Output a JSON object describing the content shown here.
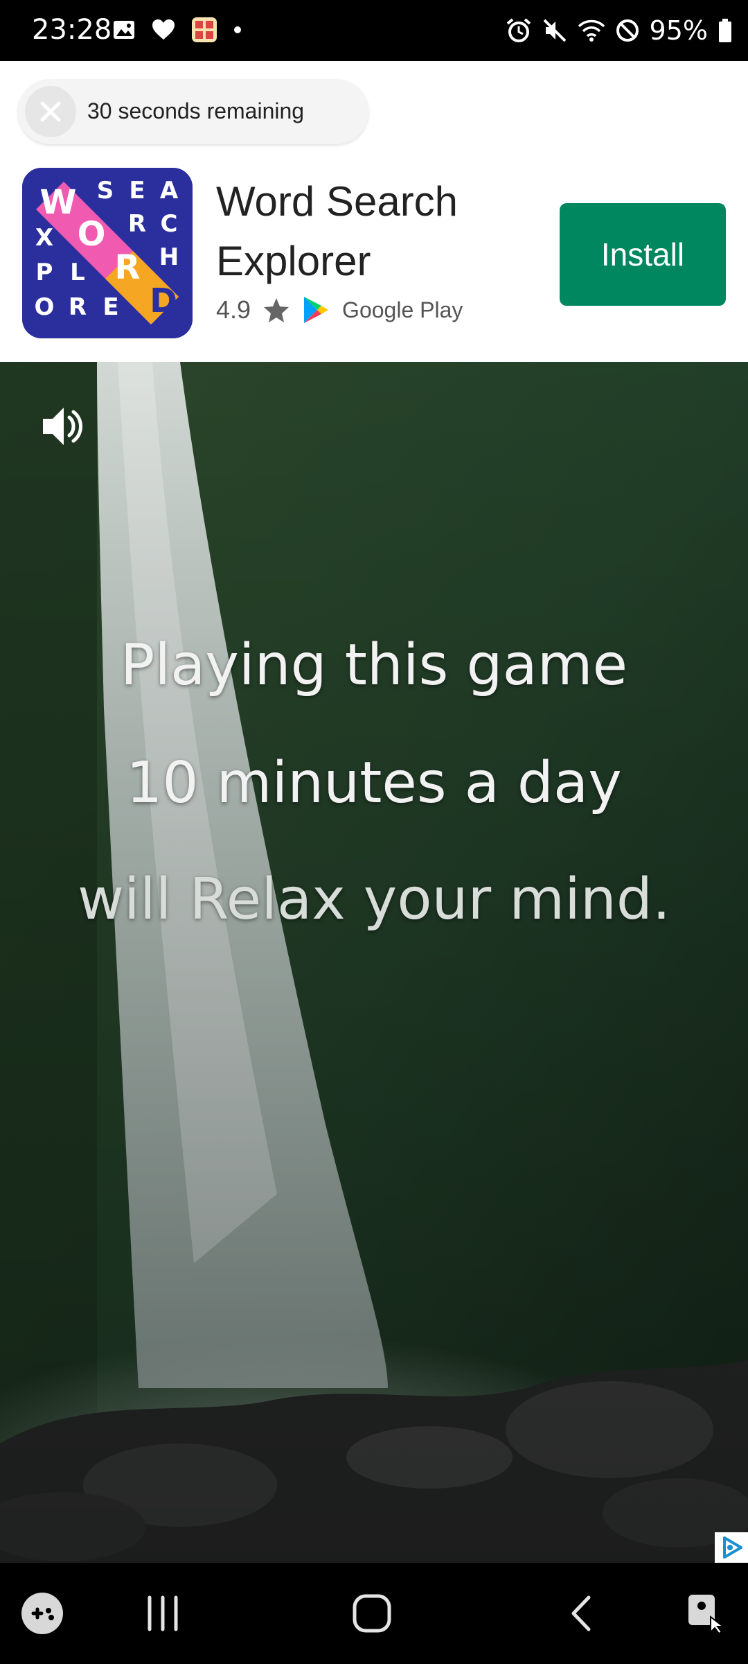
{
  "status_bar": {
    "time": "23:28",
    "battery": "95%",
    "left_icons": [
      "image-icon",
      "heart-icon",
      "game-app-icon",
      "dot-icon"
    ],
    "right_icons": [
      "alarm-icon",
      "mute-icon",
      "wifi-icon",
      "dnd-icon",
      "battery-icon"
    ]
  },
  "ad": {
    "timer_text": "30 seconds remaining",
    "app_name": "Word Search Explorer",
    "rating": "4.9",
    "store": "Google Play",
    "install_label": "Install",
    "icon_letters": [
      "W",
      "S",
      "E",
      "A",
      "O",
      "R",
      "C",
      "X",
      "H",
      "R",
      "P",
      "L",
      "D",
      "O",
      "R",
      "E"
    ],
    "colors": {
      "install": "#01875f",
      "icon_bg": "#2b2f9e",
      "icon_stripe": "#f05ab0"
    }
  },
  "video": {
    "line1": "Playing this game",
    "line2": "10 minutes a day",
    "line3": "will Relax your mind."
  },
  "nav": {
    "icons": [
      "game-launcher-icon",
      "recents-icon",
      "home-icon",
      "back-icon",
      "assistant-icon"
    ]
  }
}
